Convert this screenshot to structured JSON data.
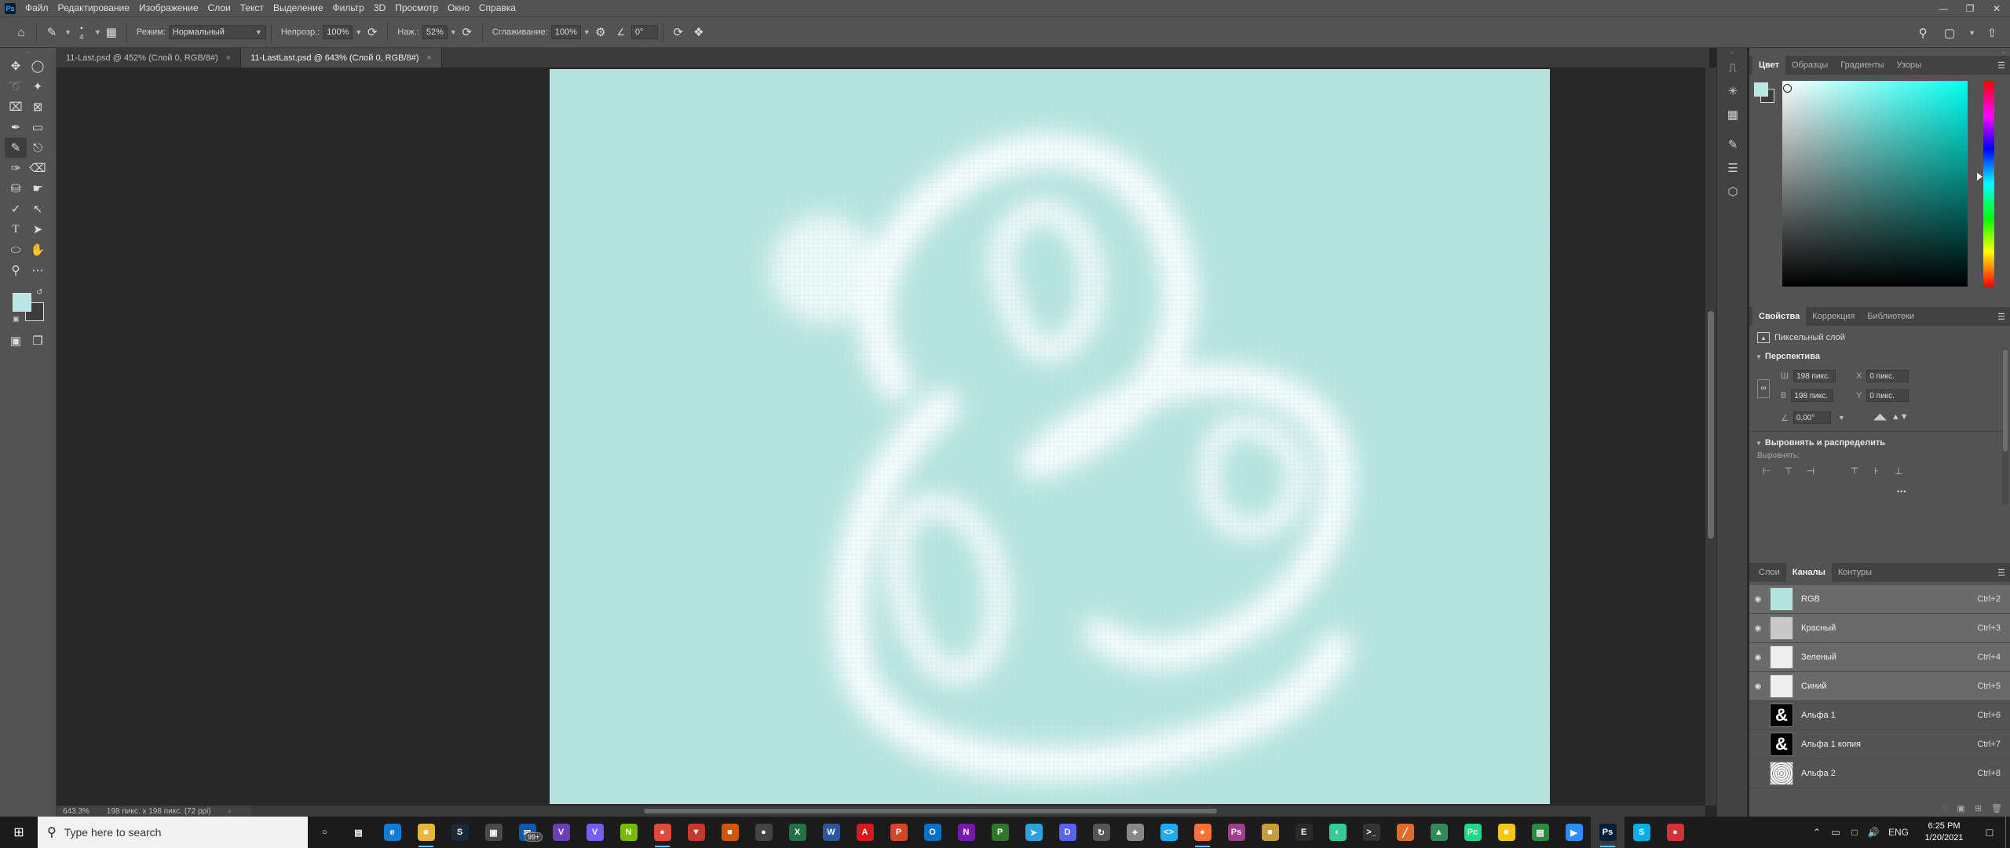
{
  "app": {
    "logo": "Ps",
    "menu": [
      "Файл",
      "Редактирование",
      "Изображение",
      "Слои",
      "Текст",
      "Выделение",
      "Фильтр",
      "3D",
      "Просмотр",
      "Окно",
      "Справка"
    ]
  },
  "options_bar": {
    "brush_size": "4",
    "mode_label": "Режим:",
    "mode_value": "Нормальный",
    "opacity_label": "Непрозр.:",
    "opacity_value": "100%",
    "pressure_label": "Наж.:",
    "pressure_value": "52%",
    "smoothing_label": "Сглаживание:",
    "smoothing_value": "100%",
    "angle_value": "0°"
  },
  "tabs": [
    {
      "label": "11-Last.psd @ 452% (Слой 0, RGB/8#)",
      "active": false
    },
    {
      "label": "11-LastLast.psd @ 643% (Слой 0, RGB/8#)",
      "active": true
    }
  ],
  "canvas": {
    "background": "#b6e3e0"
  },
  "status": {
    "zoom": "643.3%",
    "doc_info": "198 пикс. x 198 пикс. (72 ppi)",
    "arrow": "›"
  },
  "color_panel": {
    "tabs": [
      "Цвет",
      "Образцы",
      "Градиенты",
      "Узоры"
    ],
    "active_tab": "Цвет",
    "foreground": "#b8e8e6",
    "background": "#3c3c3c",
    "hue_color": "#00fff0"
  },
  "properties_panel": {
    "tabs": [
      "Свойства",
      "Коррекция",
      "Библиотеки"
    ],
    "active_tab": "Свойства",
    "layer_type": "Пиксельный слой",
    "section_transform": "Перспектива",
    "w_label": "Ш",
    "w_value": "198 пикс.",
    "h_label": "В",
    "h_value": "198 пикс.",
    "x_label": "X",
    "x_value": "0 пикс.",
    "y_label": "Y",
    "y_value": "0 пикс.",
    "angle_value": "0,00°",
    "section_align": "Выровнять и распределить",
    "align_label": "Выровнять:",
    "more": "•••"
  },
  "channels_panel": {
    "tabs": [
      "Слои",
      "Каналы",
      "Контуры"
    ],
    "active_tab": "Каналы",
    "channels": [
      {
        "name": "RGB",
        "shortcut": "Ctrl+2",
        "visible": true,
        "selected": true,
        "thumb": "rgb"
      },
      {
        "name": "Красный",
        "shortcut": "Ctrl+3",
        "visible": true,
        "selected": true,
        "thumb": "gray"
      },
      {
        "name": "Зеленый",
        "shortcut": "Ctrl+4",
        "visible": true,
        "selected": true,
        "thumb": "light"
      },
      {
        "name": "Синий",
        "shortcut": "Ctrl+5",
        "visible": true,
        "selected": true,
        "thumb": "light"
      },
      {
        "name": "Альфа 1",
        "shortcut": "Ctrl+6",
        "visible": false,
        "selected": false,
        "thumb": "amp"
      },
      {
        "name": "Альфа 1 копия",
        "shortcut": "Ctrl+7",
        "visible": false,
        "selected": false,
        "thumb": "amp"
      },
      {
        "name": "Альфа 2",
        "shortcut": "Ctrl+8",
        "visible": false,
        "selected": false,
        "thumb": "pattern"
      }
    ]
  },
  "taskbar": {
    "search_placeholder": "Type here to search",
    "mail_badge": "99+",
    "language": "ENG",
    "time": "6:25 PM",
    "date": "1/20/2021"
  }
}
